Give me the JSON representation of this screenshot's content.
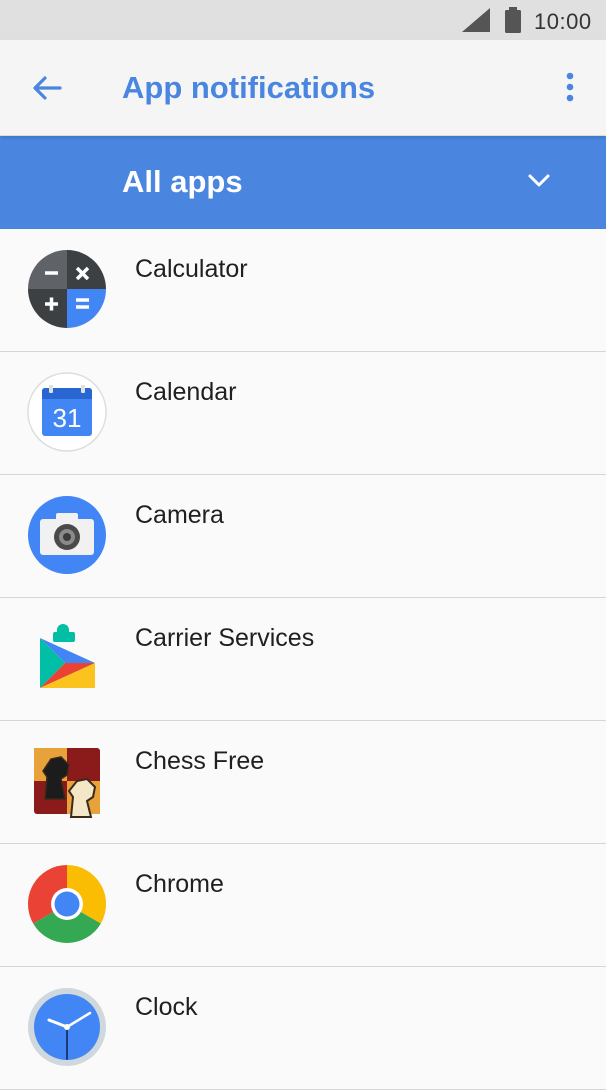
{
  "status_bar": {
    "time": "10:00"
  },
  "toolbar": {
    "title": "App notifications"
  },
  "filter": {
    "selected": "All apps"
  },
  "apps": [
    {
      "name": "Calculator",
      "icon": "calculator-icon"
    },
    {
      "name": "Calendar",
      "icon": "calendar-icon",
      "icon_text": "31"
    },
    {
      "name": "Camera",
      "icon": "camera-icon"
    },
    {
      "name": "Carrier Services",
      "icon": "carrier-services-icon"
    },
    {
      "name": "Chess Free",
      "icon": "chess-icon"
    },
    {
      "name": "Chrome",
      "icon": "chrome-icon"
    },
    {
      "name": "Clock",
      "icon": "clock-icon"
    }
  ],
  "colors": {
    "accent": "#4a86e0",
    "status_bar": "#e0e0e0",
    "background": "#fafafa"
  }
}
